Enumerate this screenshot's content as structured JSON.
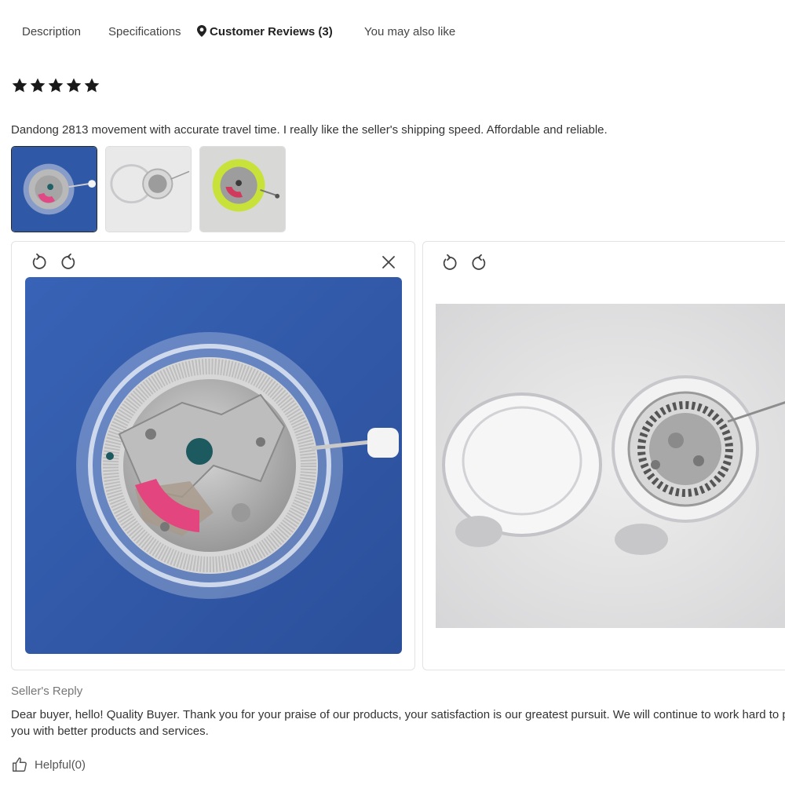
{
  "tabs": [
    {
      "label": "Description",
      "active": false
    },
    {
      "label": "Specifications",
      "active": false
    },
    {
      "label": "Customer Reviews (3)",
      "active": true,
      "icon": "location-pin-icon"
    },
    {
      "label": "You may also like",
      "active": false
    }
  ],
  "review": {
    "rating": 5,
    "rating_max": 5,
    "text": "Dandong 2813 movement with accurate travel time. I really like the seller's shipping speed. Affordable and reliable.",
    "thumbnails": [
      {
        "desc": "watch movement on blue background",
        "selected": true
      },
      {
        "desc": "movement with clear case on white",
        "selected": false
      },
      {
        "desc": "movement with green ring",
        "selected": false
      }
    ]
  },
  "viewers": {
    "left": {
      "controls": [
        "rotate-left-icon",
        "rotate-right-icon",
        "close-icon"
      ]
    },
    "right": {
      "controls": [
        "rotate-left-icon",
        "rotate-right-icon"
      ]
    }
  },
  "seller_reply": {
    "label": "Seller's Reply",
    "text": "Dear buyer, hello! Quality Buyer. Thank you for your praise of our products, your satisfaction is our greatest pursuit. We will continue to work hard to provide you with better products and services."
  },
  "helpful": {
    "label": "Helpful(0)",
    "icon": "thumbs-up-icon"
  },
  "colors": {
    "star": "#1a1a1a",
    "accent_text": "#222222",
    "muted_text": "#777777",
    "border": "#e3e3e3"
  }
}
